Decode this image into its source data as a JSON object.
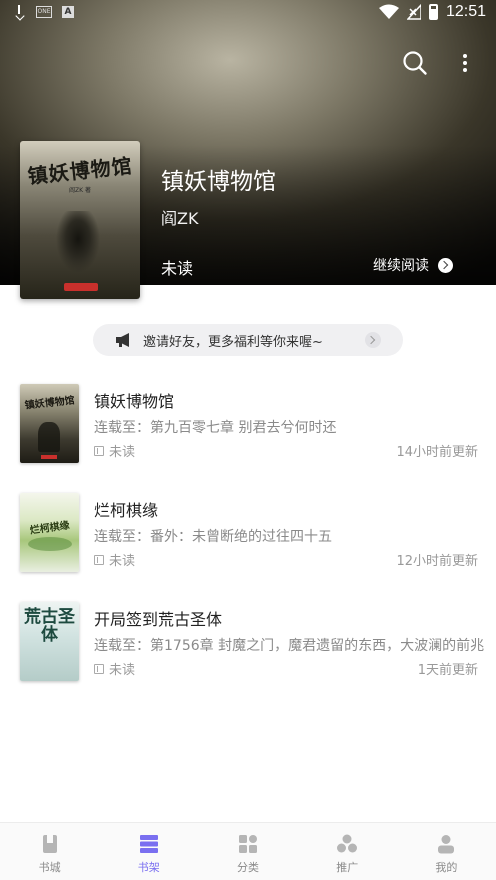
{
  "status_bar": {
    "time": "12:51",
    "left_icons": [
      "download-icon",
      "app-box-icon",
      "text-a-icon"
    ],
    "right_icons": [
      "wifi-icon",
      "signal-off-icon",
      "battery-icon"
    ],
    "box_label": "ONE",
    "a_label": "A"
  },
  "header": {
    "icons": [
      "search-icon",
      "more-vertical-icon"
    ]
  },
  "featured": {
    "title": "镇妖博物馆",
    "author": "阎ZK",
    "read_status": "未读",
    "continue_label": "继续阅读",
    "cover": {
      "title": "镇妖博物馆",
      "author_line": "阎ZK 著"
    }
  },
  "invite": {
    "text": "邀请好友，更多福利等你来喔~",
    "icon": "megaphone-icon"
  },
  "books": [
    {
      "title": "镇妖博物馆",
      "chapter": "连载至：第九百零七章 别君去兮何时还",
      "status": "未读",
      "updated": "14小时前更新",
      "cover_text": "镇妖博物馆"
    },
    {
      "title": "烂柯棋缘",
      "chapter": "连载至：番外：未曾断绝的过往四十五",
      "status": "未读",
      "updated": "12小时前更新",
      "cover_text": "烂柯棋缘"
    },
    {
      "title": "开局签到荒古圣体",
      "chapter": "连载至：第1756章 封魔之门，魔君遗留的东西，大波澜的前兆",
      "status": "未读",
      "updated": "1天前更新",
      "cover_text": "荒古圣体"
    }
  ],
  "bottom_nav": [
    {
      "label": "书城",
      "icon": "book-store-icon",
      "active": false
    },
    {
      "label": "书架",
      "icon": "bookshelf-icon",
      "active": true
    },
    {
      "label": "分类",
      "icon": "category-grid-icon",
      "active": false
    },
    {
      "label": "推广",
      "icon": "promote-icon",
      "active": false
    },
    {
      "label": "我的",
      "icon": "profile-icon",
      "active": false
    }
  ],
  "colors": {
    "accent": "#7a6ff0",
    "nav_inactive": "#8a8a8a",
    "text_secondary": "#8a8a8a"
  }
}
